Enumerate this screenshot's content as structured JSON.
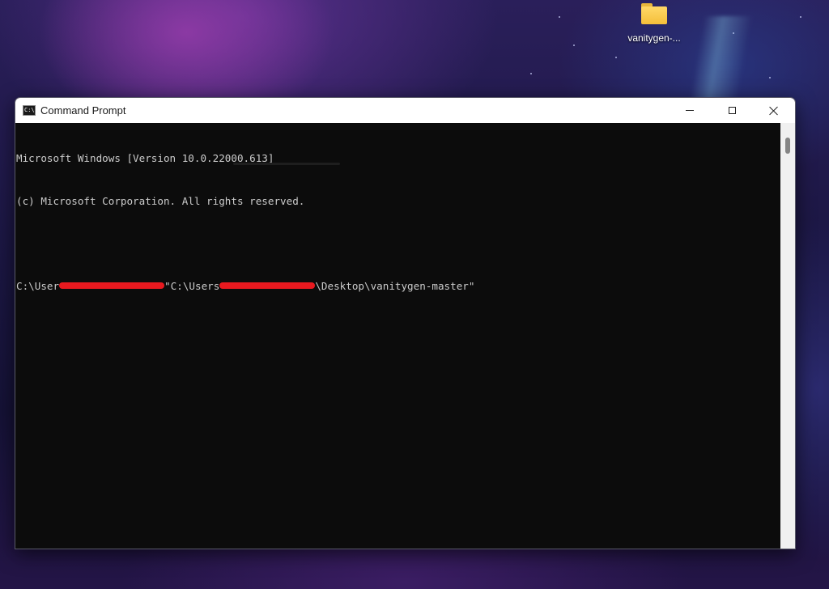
{
  "desktop": {
    "icon_label": "vanitygen-..."
  },
  "window": {
    "title": "Command Prompt",
    "app_icon_text": "C:\\"
  },
  "console": {
    "line1": "Microsoft Windows [Version 10.0.22000.613]",
    "line2": "(c) Microsoft Corporation. All rights reserved.",
    "prompt_prefix": "C:\\User",
    "cmd_mid": "\"C:\\Users",
    "cmd_suffix": "\\Desktop\\vanitygen-master\""
  },
  "colors": {
    "console_bg": "#0c0c0c",
    "console_text": "#cccccc",
    "redaction": "#e8191f",
    "titlebar_bg": "#ffffff"
  }
}
